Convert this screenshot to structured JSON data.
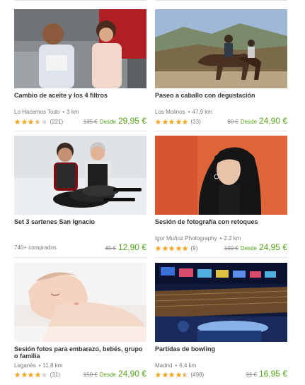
{
  "colors": {
    "price_green": "#53a318",
    "star": "#f5a623",
    "star_empty": "#d8d8d8"
  },
  "deals": [
    {
      "title": "Cambio de aceite y los 4 filtros",
      "merchant": "Lo Hacemos Todo",
      "distance": "3 km",
      "rating": 3.5,
      "review_count": "(221)",
      "old_price": "135 €",
      "desde": "Desde",
      "price": "29,95 €",
      "image_icon": "mechanic-photo"
    },
    {
      "title": "Paseo a caballo con degustación",
      "merchant": "Los Molinos",
      "distance": "47,9 km",
      "rating": 5,
      "review_count": "(33)",
      "old_price": "60 €",
      "desde": "Desde",
      "price": "24,90 €",
      "image_icon": "horse-riding-photo"
    },
    {
      "title": "Set 3 sartenes San Ignacio",
      "sold": "740+ comprados",
      "old_price": "45 €",
      "price": "12,90 €",
      "image_icon": "frying-pans-photo"
    },
    {
      "title": "Sesión de fotografía con retoques",
      "merchant": "Igor Muñoz Photography",
      "distance": "2,2 km",
      "rating": 5,
      "review_count": "(9)",
      "old_price": "100 €",
      "desde": "Desde",
      "price": "24,95 €",
      "image_icon": "portrait-photo"
    },
    {
      "title": "Sesión fotos para embarazo, bebés, grupo o familia",
      "merchant": "Leganés",
      "distance": "11,8 km",
      "rating": 4,
      "review_count": "(31)",
      "old_price": "150 €",
      "desde": "Desde",
      "price": "24,90 €",
      "image_icon": "sleeping-baby-photo"
    },
    {
      "title": "Partidas de bowling",
      "merchant": "Madrid",
      "distance": "6,4 km",
      "rating": 4.5,
      "review_count": "(498)",
      "old_price": "31 €",
      "price": "16,95 €",
      "image_icon": "bowling-alley-photo"
    }
  ]
}
